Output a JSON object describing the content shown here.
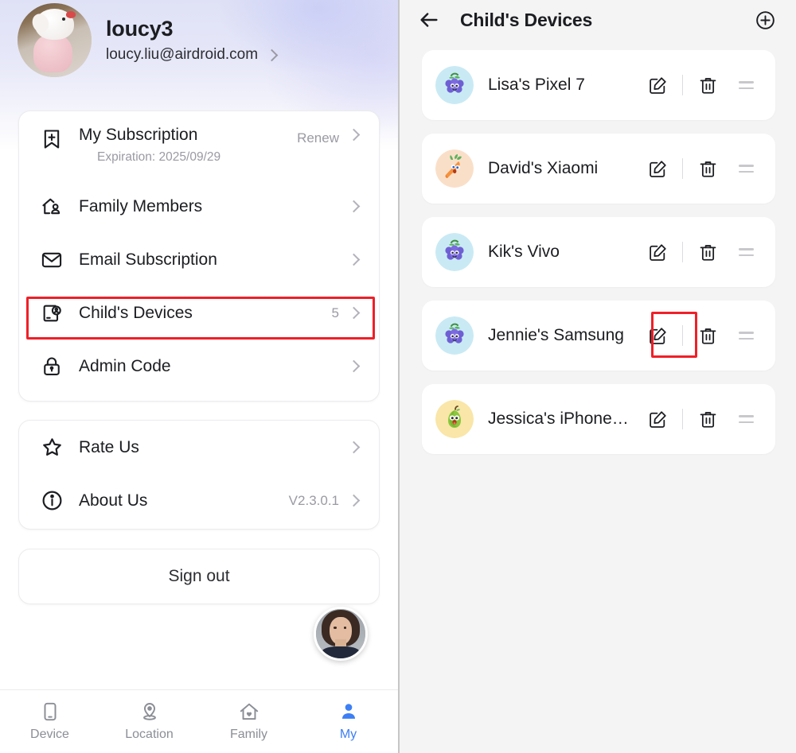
{
  "left": {
    "profile": {
      "avatar_icon": "user-photo-avatar",
      "name": "loucy3",
      "email": "loucy.liu@airdroid.com",
      "chevron_icon": "chevron-right-icon"
    },
    "menu_card": {
      "items": [
        {
          "icon": "bookmark-plus-icon",
          "label": "My Subscription",
          "meta": "Renew",
          "sub": "Expiration: 2025/09/29"
        },
        {
          "icon": "home-person-icon",
          "label": "Family Members",
          "meta": "",
          "sub": ""
        },
        {
          "icon": "envelope-icon",
          "label": "Email Subscription",
          "meta": "",
          "sub": ""
        },
        {
          "icon": "tablet-person-icon",
          "label": "Child's Devices",
          "meta": "5",
          "sub": ""
        },
        {
          "icon": "padlock-icon",
          "label": "Admin Code",
          "meta": "",
          "sub": ""
        }
      ]
    },
    "info_card": {
      "items": [
        {
          "icon": "star-icon",
          "label": "Rate Us",
          "meta": ""
        },
        {
          "icon": "info-circle-icon",
          "label": "About Us",
          "meta": "V2.3.0.1"
        }
      ]
    },
    "sign_out_label": "Sign out",
    "floating_avatar_icon": "person-photo-avatar",
    "bottom_nav": {
      "items": [
        {
          "icon": "phone-icon",
          "label": "Device",
          "active": false
        },
        {
          "icon": "location-pin-icon",
          "label": "Location",
          "active": false
        },
        {
          "icon": "home-heart-icon",
          "label": "Family",
          "active": false
        },
        {
          "icon": "person-icon",
          "label": "My",
          "active": true
        }
      ],
      "active_color": "#3d7ff5",
      "inactive_color": "#8b8e96"
    }
  },
  "right": {
    "header": {
      "back_icon": "arrow-left-icon",
      "title": "Child's Devices",
      "add_icon": "plus-circle-icon"
    },
    "devices": [
      {
        "avatar_icon": "grape-face-avatar",
        "name": "Lisa's Pixel 7",
        "edit_icon": "edit-square-icon",
        "delete_icon": "trash-icon",
        "drag_icon": "drag-handle-icon"
      },
      {
        "avatar_icon": "carrot-face-avatar",
        "name": "David's Xiaomi",
        "edit_icon": "edit-square-icon",
        "delete_icon": "trash-icon",
        "drag_icon": "drag-handle-icon"
      },
      {
        "avatar_icon": "grape-face-avatar",
        "name": "Kik's Vivo",
        "edit_icon": "edit-square-icon",
        "delete_icon": "trash-icon",
        "drag_icon": "drag-handle-icon"
      },
      {
        "avatar_icon": "grape-face-avatar",
        "name": "Jennie's Samsung",
        "edit_icon": "edit-square-icon",
        "delete_icon": "trash-icon",
        "drag_icon": "drag-handle-icon"
      },
      {
        "avatar_icon": "pear-face-avatar",
        "name": "Jessica's iPhone…",
        "edit_icon": "edit-square-icon",
        "delete_icon": "trash-icon",
        "drag_icon": "drag-handle-icon"
      }
    ]
  },
  "highlights": {
    "color": "#f01f28",
    "boxes": [
      {
        "name": "childs-devices-row",
        "target": "Child's Devices"
      },
      {
        "name": "edit-jennies-samsung",
        "target": "Jennie's Samsung edit button"
      }
    ]
  }
}
